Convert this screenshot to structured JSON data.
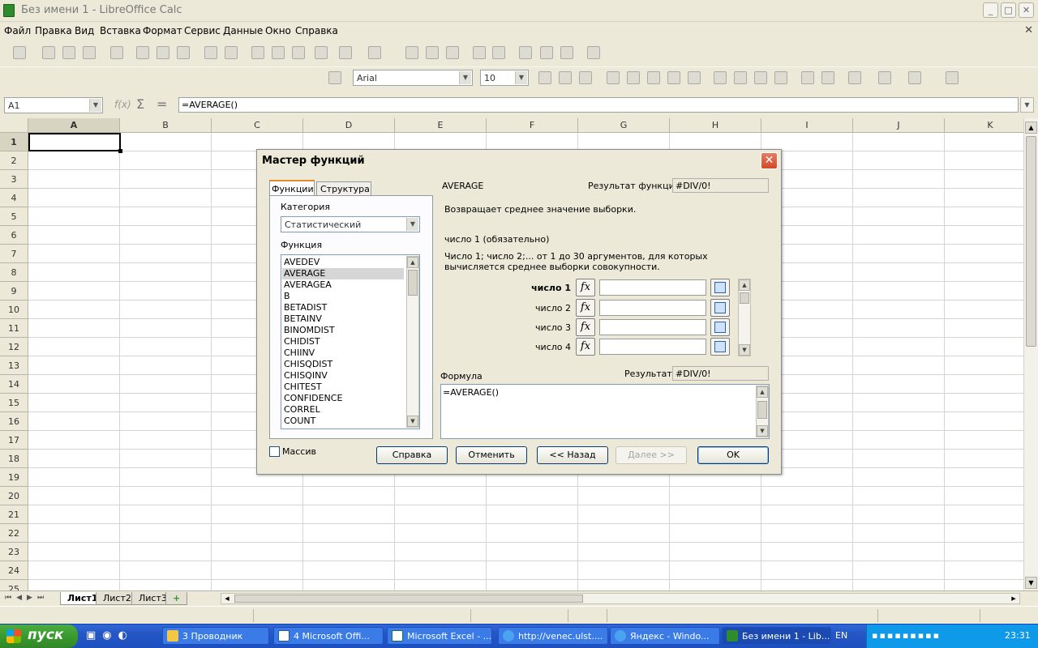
{
  "window": {
    "title": "Без имени 1 - LibreOffice Calc",
    "min": "_",
    "max": "□",
    "close": "✕"
  },
  "menu": [
    "Файл",
    "Правка",
    "Вид",
    "Вставка",
    "Формат",
    "Сервис",
    "Данные",
    "Окно",
    "Справка"
  ],
  "formatting": {
    "font": "Arial",
    "size": "10"
  },
  "formula_bar": {
    "cell_ref": "A1",
    "fx": "f(x)",
    "sum": "Σ",
    "eq": "=",
    "content": "=AVERAGE()"
  },
  "grid": {
    "columns": [
      "A",
      "B",
      "C",
      "D",
      "E",
      "F",
      "G",
      "H",
      "I",
      "J",
      "K"
    ],
    "rows": [
      "1",
      "2",
      "3",
      "4",
      "5",
      "6",
      "7",
      "8",
      "9",
      "10",
      "11",
      "12",
      "13",
      "14",
      "15",
      "16",
      "17",
      "18",
      "19",
      "20",
      "21",
      "22",
      "23",
      "24",
      "25"
    ]
  },
  "sheets": {
    "tabs": [
      "Лист1",
      "Лист2",
      "Лист3"
    ],
    "active": "Лист1",
    "add": "+"
  },
  "dialog": {
    "title": "Мастер функций",
    "tab_functions": "Функции",
    "tab_structure": "Структура",
    "category_label": "Категория",
    "category_value": "Статистический",
    "function_label": "Функция",
    "functions": [
      "AVEDEV",
      "AVERAGE",
      "AVERAGEA",
      "B",
      "BETADIST",
      "BETAINV",
      "BINOMDIST",
      "CHIDIST",
      "CHIINV",
      "CHISQDIST",
      "CHISQINV",
      "CHITEST",
      "CONFIDENCE",
      "CORREL",
      "COUNT"
    ],
    "selected_function": "AVERAGE",
    "func_name": "AVERAGE",
    "func_result_label": "Результат функции",
    "func_result_value": "#DIV/0!",
    "description": "Возвращает среднее значение выборки.",
    "arg_title": "число 1 (обязательно)",
    "arg_desc": "Число 1; число 2;... от 1 до 30 аргументов, для которых вычисляется среднее выборки совокупности.",
    "args": [
      "число 1",
      "число 2",
      "число 3",
      "число 4"
    ],
    "formula_label": "Формула",
    "result_label": "Результат",
    "result_value": "#DIV/0!",
    "formula_text": "=AVERAGE()",
    "array_label": "Массив",
    "btn_help": "Справка",
    "btn_cancel": "Отменить",
    "btn_back": "<< Назад",
    "btn_next": "Далее >>",
    "btn_ok": "OK"
  },
  "taskbar": {
    "start": "пуск",
    "tasks": [
      "3 Проводник",
      "4 Microsoft Offi...",
      "Microsoft Excel - ...",
      "http://venec.ulst....",
      "Яндекс - Windo...",
      "Без имени 1 - Lib..."
    ],
    "lang": "EN",
    "clock": "23:31"
  }
}
